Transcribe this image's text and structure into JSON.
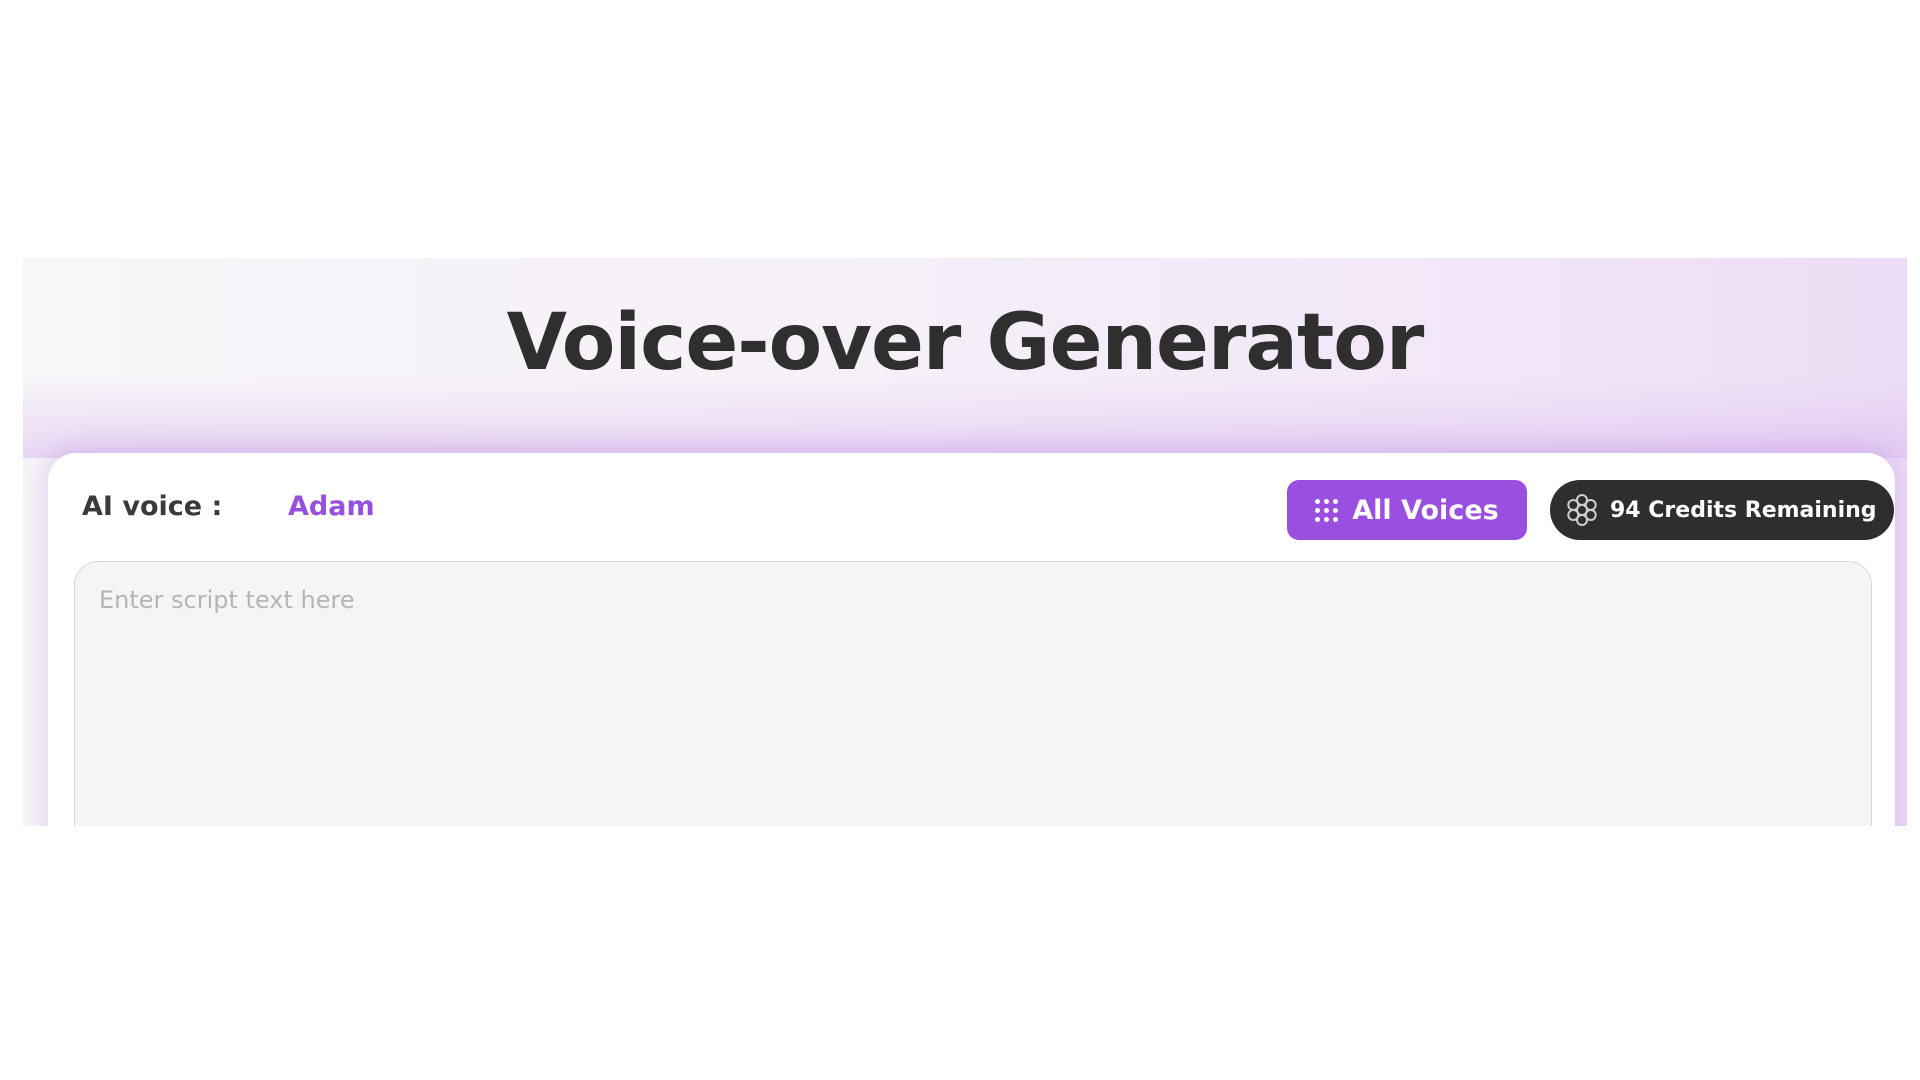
{
  "page": {
    "title": "Voice-over Generator"
  },
  "voice": {
    "label": "AI voice :",
    "selected": "Adam"
  },
  "toolbar": {
    "all_voices_label": "All Voices",
    "credits_label": "94 Credits Remaining"
  },
  "script": {
    "value": "",
    "placeholder": "Enter script text here"
  },
  "icons": {
    "all_voices": "grid-dots-icon",
    "credits": "credits-coin-icon"
  },
  "colors": {
    "accent": "#9a4fe0",
    "accent_text": "#9650dd",
    "badge_bg": "#2e2e2e",
    "title_text": "#2f2f2f"
  }
}
